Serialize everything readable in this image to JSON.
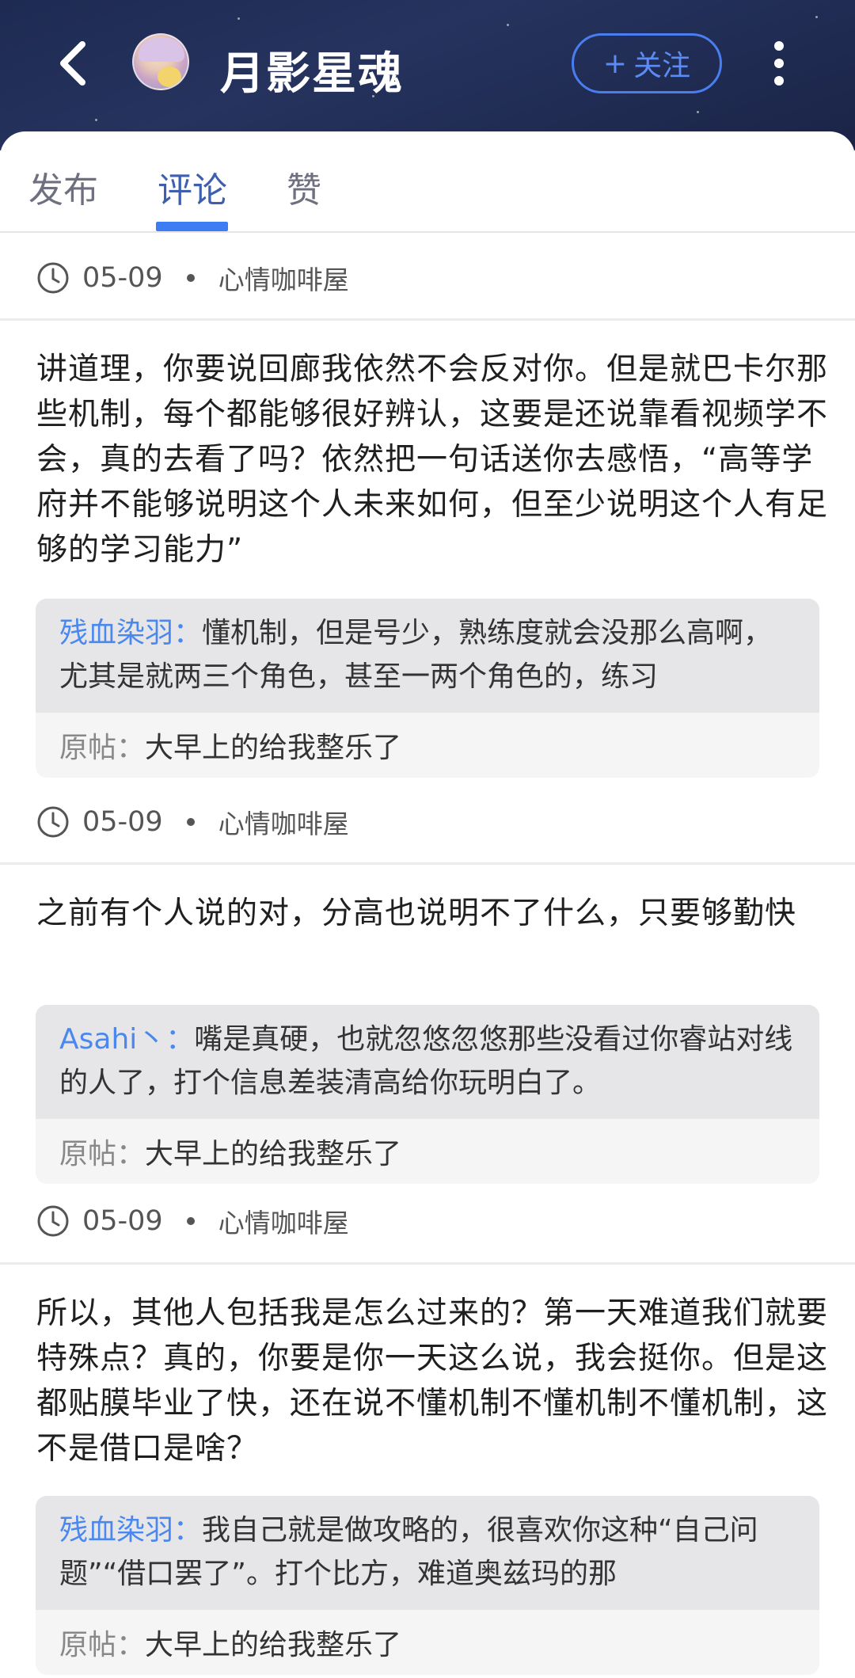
{
  "header": {
    "title": "月影星魂",
    "follow_label": "关注",
    "follow_plus": "+"
  },
  "tabs": [
    {
      "label": "发布"
    },
    {
      "label": "评论"
    },
    {
      "label": "赞"
    }
  ],
  "active_tab": "评论",
  "items": [
    {
      "date": "05-09",
      "board": "心情咖啡屋"
    },
    {
      "text": "讲道理，你要说回廊我依然不会反对你。但是就巴卡尔那些机制，每个都能够很好辨认，这要是还说靠看视频学不会，真的去看了吗？依然把一句话送你去感悟，“高等学府并不能够说明这个人未来如何，但至少说明这个人有足够的学习能力”",
      "quote_author": "残血染羽：",
      "quote_text": "懂机制，但是号少，熟练度就会没那么高啊，尤其是就两三个角色，甚至一两个角色的，练习",
      "origin_label": "原帖：",
      "origin_text": "大早上的给我整乐了",
      "date": "05-09",
      "board": "心情咖啡屋"
    },
    {
      "text": "之前有个人说的对，分高也说明不了什么，只要够勤快",
      "quote_author": "Asahi丶：",
      "quote_text": "嘴是真硬，也就忽悠忽悠那些没看过你睿站对线的人了，打个信息差装清高给你玩明白了。",
      "origin_label": "原帖：",
      "origin_text": "大早上的给我整乐了",
      "date": "05-09",
      "board": "心情咖啡屋"
    },
    {
      "text": "所以，其他人包括我是怎么过来的？第一天难道我们就要特殊点？真的，你要是你一天这么说，我会挺你。但是这都贴膜毕业了快，还在说不懂机制不懂机制不懂机制，这不是借口是啥？",
      "quote_author": "残血染羽：",
      "quote_text": "我自己就是做攻略的，很喜欢你这种“自己问题”“借口罢了”。打个比方，难道奥兹玛的那",
      "origin_label": "原帖：",
      "origin_text": "大早上的给我整乐了"
    }
  ],
  "colors": {
    "header_bg": "#1e2a52",
    "accent_blue": "#3d7cf2",
    "active_tab": "#3e5fb0",
    "quote_author": "#4a88f0"
  },
  "icons": [
    "back-chevron-icon",
    "more-vertical-icon",
    "clock-icon",
    "plus-icon"
  ]
}
